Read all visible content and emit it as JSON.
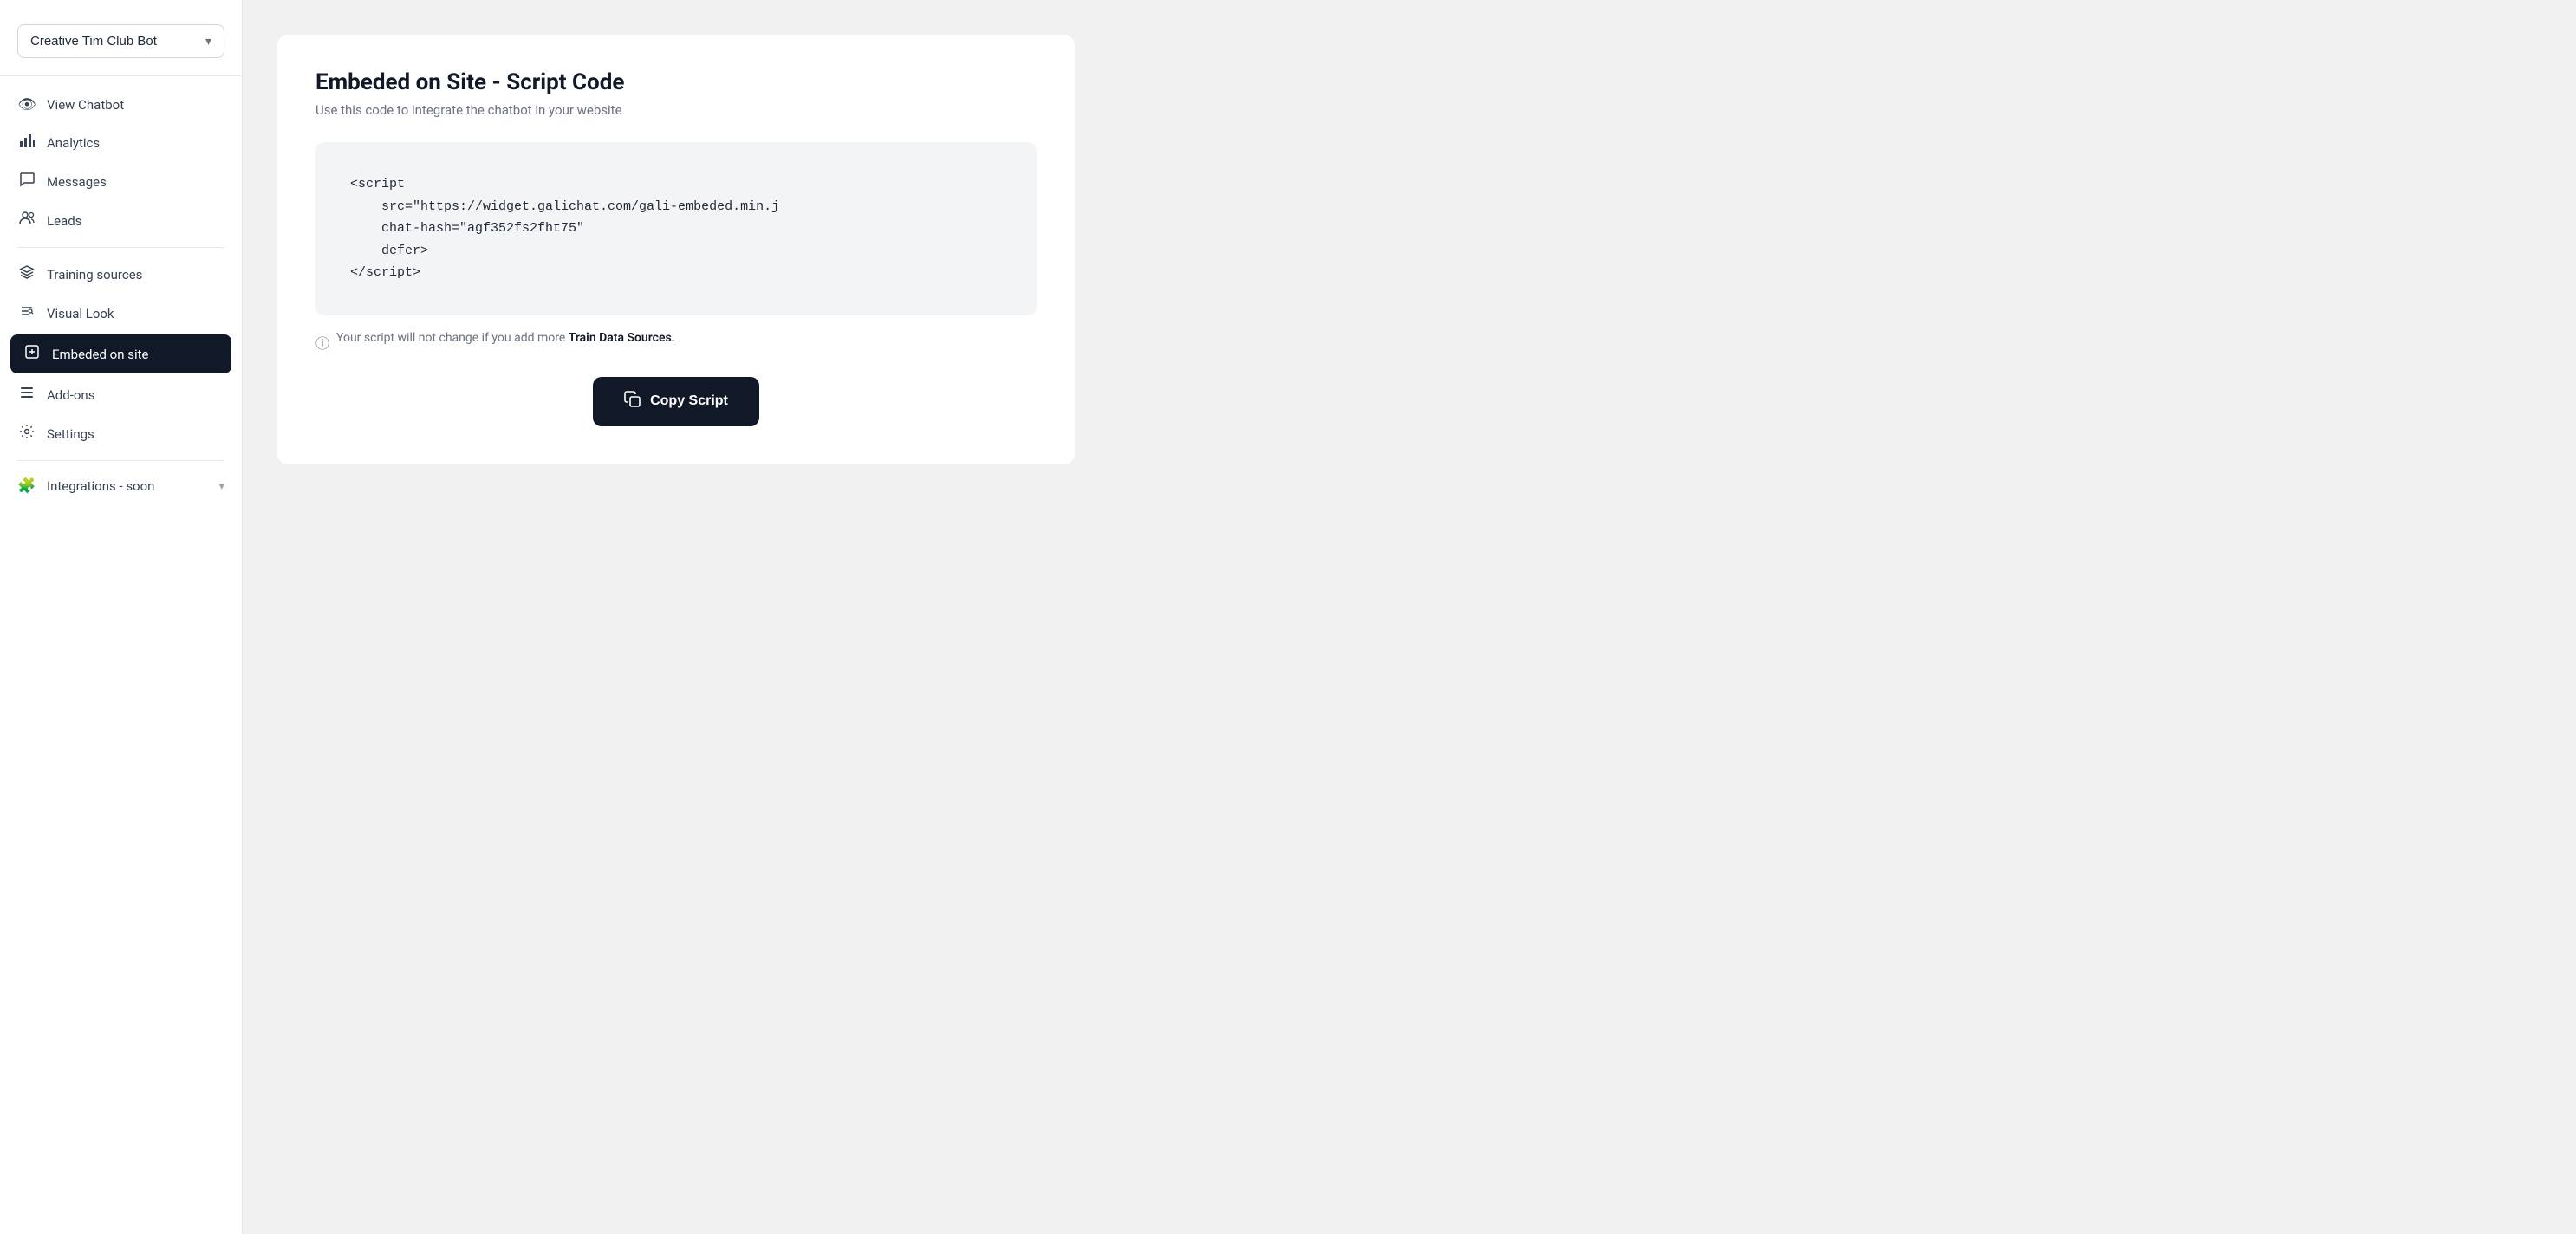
{
  "sidebar": {
    "bot_selector": {
      "name": "Creative Tim Club Bot",
      "chevron": "▾"
    },
    "nav_items": [
      {
        "id": "view-chatbot",
        "label": "View Chatbot",
        "icon": "👁",
        "active": false
      },
      {
        "id": "analytics",
        "label": "Analytics",
        "icon": "📊",
        "active": false
      },
      {
        "id": "messages",
        "label": "Messages",
        "icon": "💬",
        "active": false
      },
      {
        "id": "leads",
        "label": "Leads",
        "icon": "👥",
        "active": false
      },
      {
        "id": "training-sources",
        "label": "Training sources",
        "icon": "🎓",
        "active": false
      },
      {
        "id": "visual-look",
        "label": "Visual Look",
        "icon": "⚙",
        "active": false
      },
      {
        "id": "embeded-on-site",
        "label": "Embeded on site",
        "icon": "◈",
        "active": true
      },
      {
        "id": "add-ons",
        "label": "Add-ons",
        "icon": "☰",
        "active": false
      },
      {
        "id": "settings",
        "label": "Settings",
        "icon": "⚙",
        "active": false
      },
      {
        "id": "integrations",
        "label": "Integrations - soon",
        "icon": "🧩",
        "active": false,
        "chevron": true
      }
    ]
  },
  "main": {
    "title": "Embeded on Site - Script Code",
    "subtitle": "Use this code to integrate the chatbot in your website",
    "code": "<script\n    src=\"https://widget.galichat.com/gali-embeded.min.j\n    chat-hash=\"agf352fs2fht75\"\n    defer>\n</script>",
    "info_text": "Your script will not change if you add more ",
    "info_link": "Train Data Sources.",
    "copy_button_label": "Copy Script"
  }
}
